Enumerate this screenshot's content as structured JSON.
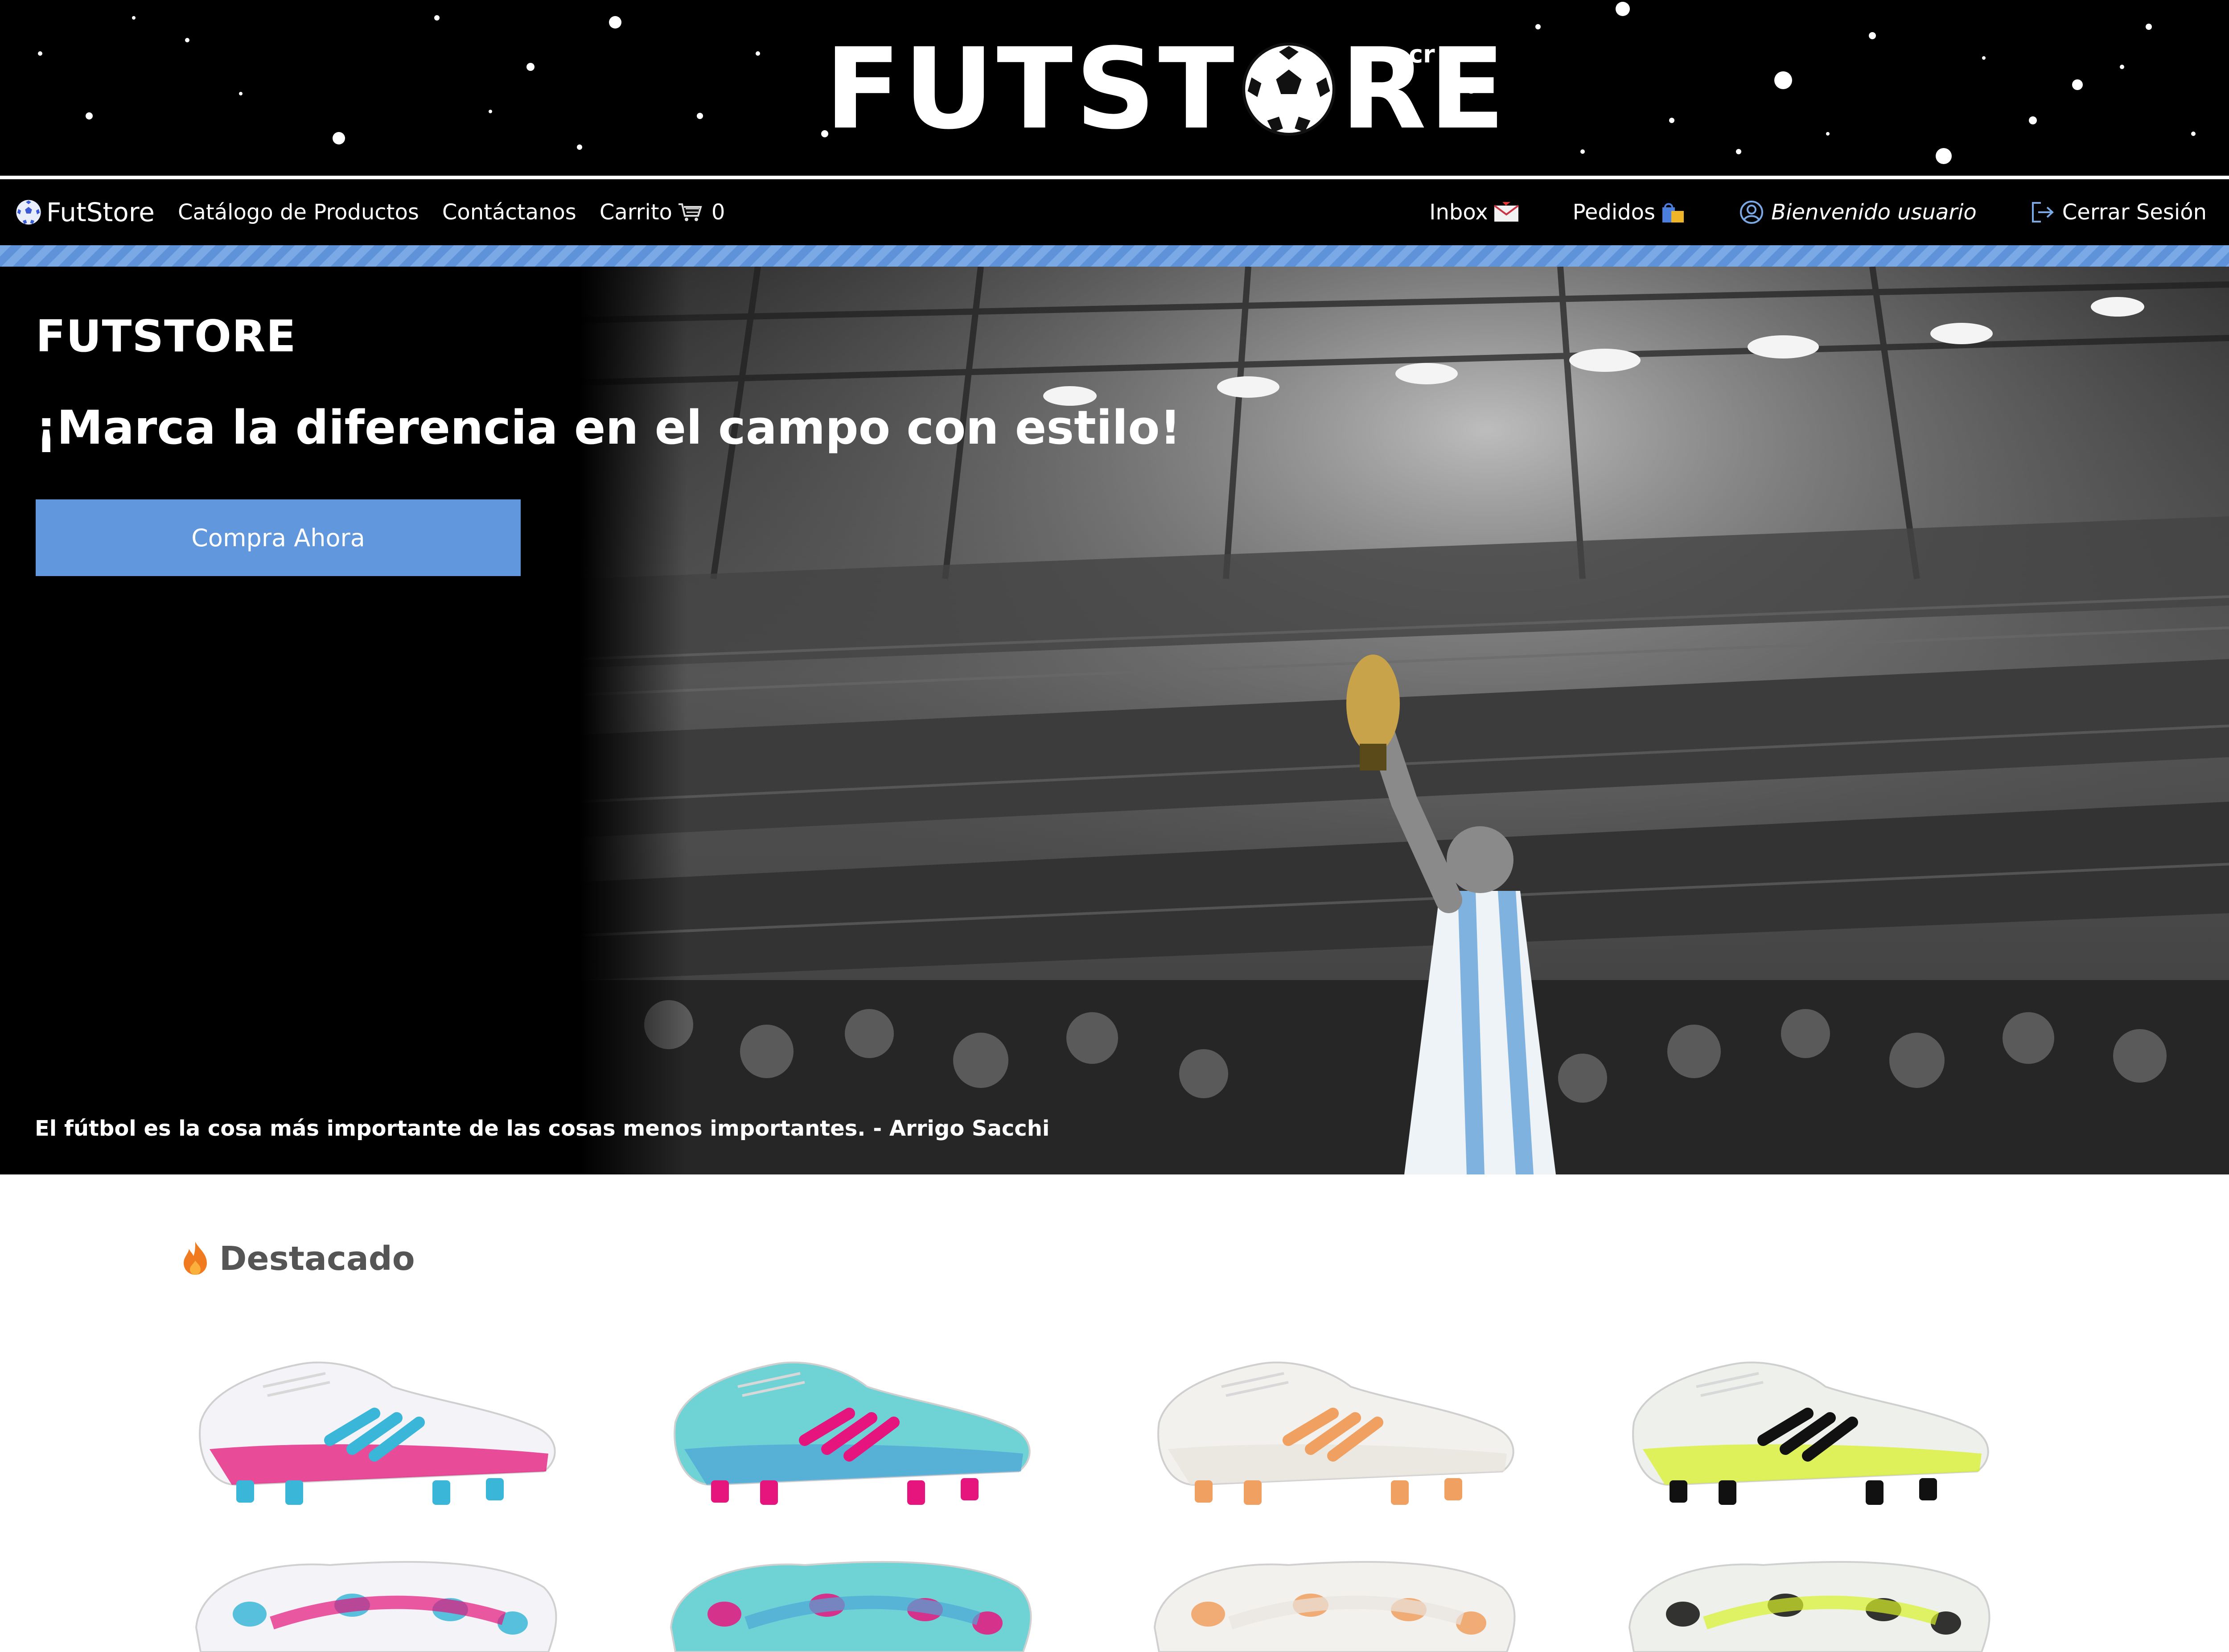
{
  "banner": {
    "logo_text_left": "FUTST",
    "logo_text_right": "RE",
    "logo_superscript": "cr"
  },
  "navbar": {
    "brand": "FutStore",
    "catalog": "Catálogo de Productos",
    "contact": "Contáctanos",
    "cart_label": "Carrito",
    "cart_count": "0",
    "inbox": "Inbox",
    "orders": "Pedidos",
    "welcome": "Bienvenido usuario",
    "logout": "Cerrar Sesión"
  },
  "hero": {
    "brand": "FUTSTORE",
    "tagline": "¡Marca la diferencia en el campo con estilo!",
    "cta": "Compra Ahora",
    "quote": "El fútbol es la cosa más importante de las cosas menos importantes. - Arrigo Sacchi"
  },
  "featured": {
    "title": "Destacado",
    "products": [
      {
        "color_base": "#f4f4f8",
        "color_accent": "#3ab6d8",
        "color_detail": "#e4147a"
      },
      {
        "color_base": "#6fd3d6",
        "color_accent": "#e6157e",
        "color_detail": "#4fa6d6"
      },
      {
        "color_base": "#f3f1ee",
        "color_accent": "#f0a060",
        "color_detail": "#e8e4de"
      },
      {
        "color_base": "#eef0ec",
        "color_accent": "#111111",
        "color_detail": "#d8f22a"
      }
    ]
  },
  "colors": {
    "accent": "#6197dd",
    "navbar": "#000000",
    "stripe": "#7aa9e6"
  }
}
